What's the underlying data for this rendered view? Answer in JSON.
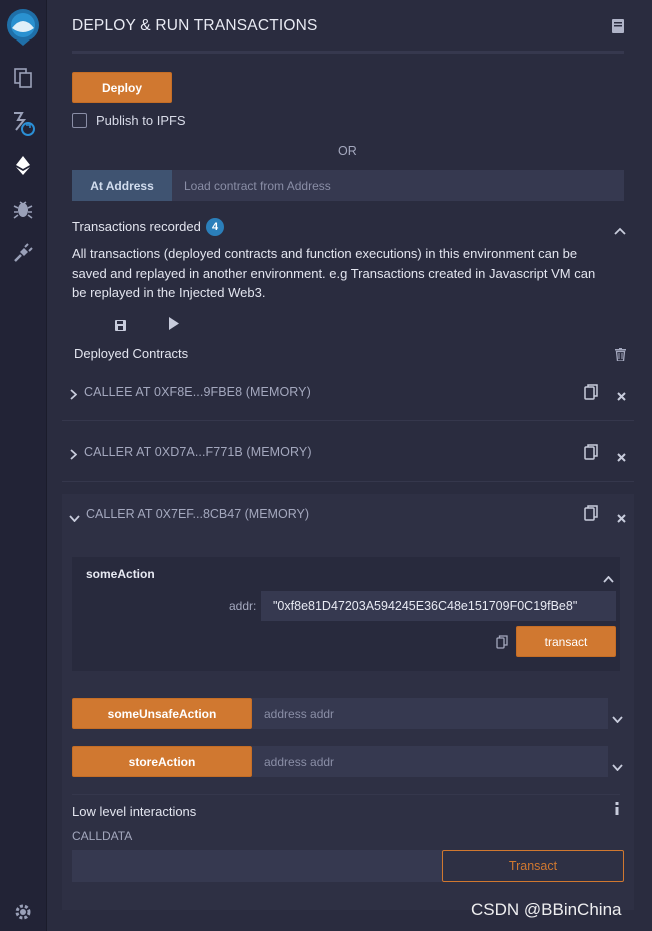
{
  "panel": {
    "title": "DEPLOY & RUN TRANSACTIONS"
  },
  "deploy": {
    "deploy_label": "Deploy",
    "publish_label": "Publish to IPFS",
    "or_label": "OR",
    "at_address_label": "At Address",
    "address_placeholder": "Load contract from Address"
  },
  "transactions": {
    "title": "Transactions recorded",
    "count": "4",
    "description": "All transactions (deployed contracts and function executions) in this environment can be saved and replayed in another environment. e.g Transactions created in Javascript VM can be replayed in the Injected Web3."
  },
  "deployed": {
    "title": "Deployed Contracts",
    "contracts": [
      {
        "label": "CALLEE AT 0XF8E...9FBE8 (MEMORY)"
      },
      {
        "label": "CALLER AT 0XD7A...F771B (MEMORY)"
      },
      {
        "label": "CALLER AT 0X7EF...8CB47 (MEMORY)"
      }
    ]
  },
  "functions": {
    "some_action": {
      "name": "someAction",
      "param_label": "addr:",
      "param_value": "\"0xf8e81D47203A594245E36C48e151709F0C19fBe8\"",
      "transact_label": "transact"
    },
    "some_unsafe_action": {
      "name": "someUnsafeAction",
      "placeholder": "address addr"
    },
    "store_action": {
      "name": "storeAction",
      "placeholder": "address addr"
    }
  },
  "low_level": {
    "title": "Low level interactions",
    "calldata_label": "CALLDATA",
    "transact_label": "Transact"
  },
  "watermark": "CSDN @BBinChina",
  "colors": {
    "accent": "#d07830",
    "badge": "#2b7fba",
    "background": "#2a2c3f"
  }
}
